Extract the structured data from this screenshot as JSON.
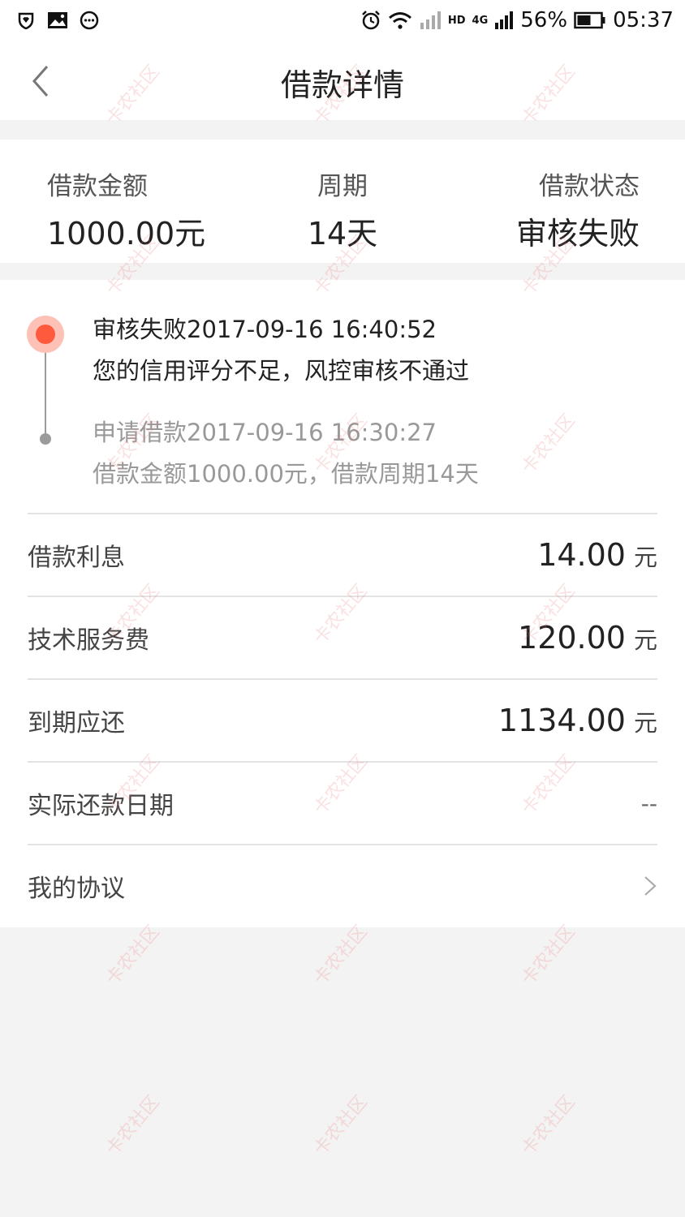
{
  "status_bar": {
    "battery": "56%",
    "time": "05:37",
    "hd": "HD",
    "network": "4G",
    "icons": [
      "shield-heart-icon",
      "gallery-icon",
      "chat-bubble-icon",
      "alarm-icon",
      "wifi-icon",
      "signal-icon",
      "battery-icon"
    ]
  },
  "nav": {
    "title": "借款详情"
  },
  "summary": {
    "amount_label": "借款金额",
    "amount_value": "1000.00元",
    "period_label": "周期",
    "period_value": "14天",
    "status_label": "借款状态",
    "status_value": "审核失败"
  },
  "timeline": [
    {
      "title": "审核失败2017-09-16 16:40:52",
      "desc": "您的信用评分不足，风控审核不通过"
    },
    {
      "title": "申请借款2017-09-16 16:30:27",
      "desc": "借款金额1000.00元，借款周期14天"
    }
  ],
  "rows": {
    "interest_label": "借款利息",
    "interest_value": "14.00",
    "interest_unit": "元",
    "service_label": "技术服务费",
    "service_value": "120.00",
    "service_unit": "元",
    "due_label": "到期应还",
    "due_value": "1134.00",
    "due_unit": "元",
    "actual_date_label": "实际还款日期",
    "actual_date_value": "--",
    "agreement_label": "我的协议"
  },
  "watermark_text": "卡农社区",
  "colors": {
    "accent": "#fe5a3d",
    "accent_halo": "#fdc1b6",
    "background": "#f4f3f3"
  }
}
